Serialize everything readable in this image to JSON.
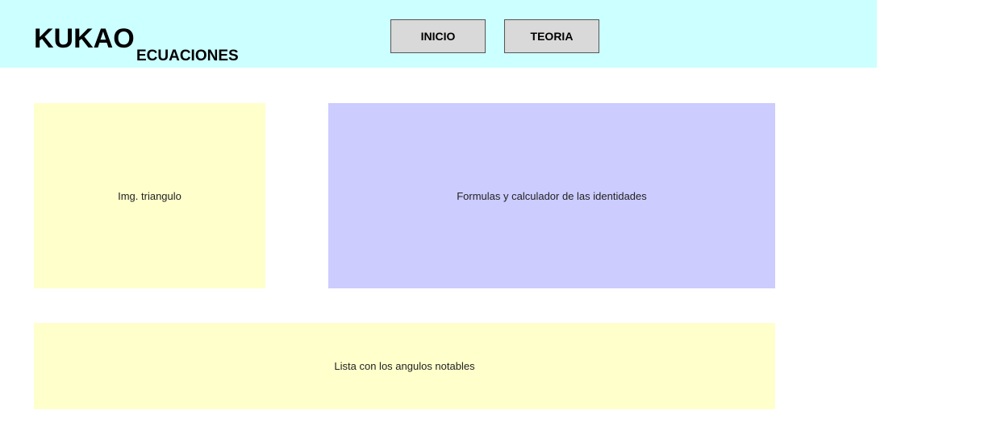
{
  "header": {
    "logo": "KUKAO",
    "subtitle": "ECUACIONES",
    "nav": {
      "inicio_label": "INICIO",
      "teoria_label": "TEORIA"
    }
  },
  "main": {
    "triangle_panel_label": "Img. triangulo",
    "formulas_panel_label": "Formulas y calculador de las identidades",
    "angles_panel_label": "Lista con los angulos notables"
  },
  "colors": {
    "header_bg": "#ccffff",
    "yellow_panel": "#ffffcc",
    "blue_panel": "#ccccff",
    "button_bg": "#d9d9d9"
  }
}
